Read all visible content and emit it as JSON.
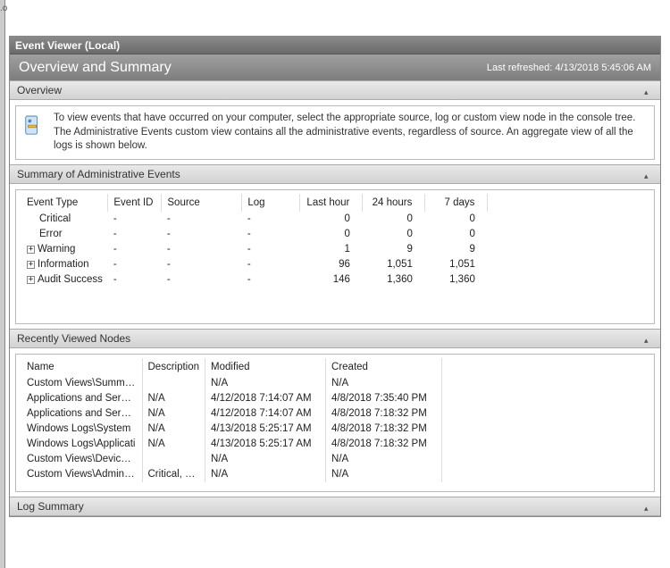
{
  "window": {
    "title": "Event Viewer (Local)",
    "edge_label": ".o"
  },
  "banner": {
    "title": "Overview and Summary",
    "refreshed_prefix": "Last refreshed: ",
    "refreshed_time": "4/13/2018 5:45:06 AM"
  },
  "overview": {
    "header": "Overview",
    "text": "To view events that have occurred on your computer, select the appropriate source, log or custom view node in the console tree. The Administrative Events custom view contains all the administrative events, regardless of source. An aggregate view of all the logs is shown below."
  },
  "summary": {
    "header": "Summary of Administrative Events",
    "columns": {
      "event_type": "Event Type",
      "event_id": "Event ID",
      "source": "Source",
      "log": "Log",
      "last_hour": "Last hour",
      "h24": "24 hours",
      "d7": "7 days"
    },
    "rows": [
      {
        "expand": "",
        "indent": true,
        "type": "Critical",
        "id": "-",
        "source": "-",
        "log": "-",
        "last_hour": "0",
        "h24": "0",
        "d7": "0"
      },
      {
        "expand": "",
        "indent": true,
        "type": "Error",
        "id": "-",
        "source": "-",
        "log": "-",
        "last_hour": "0",
        "h24": "0",
        "d7": "0"
      },
      {
        "expand": "+",
        "indent": false,
        "type": "Warning",
        "id": "-",
        "source": "-",
        "log": "-",
        "last_hour": "1",
        "h24": "9",
        "d7": "9"
      },
      {
        "expand": "+",
        "indent": false,
        "type": "Information",
        "id": "-",
        "source": "-",
        "log": "-",
        "last_hour": "96",
        "h24": "1,051",
        "d7": "1,051"
      },
      {
        "expand": "+",
        "indent": false,
        "type": "Audit Success",
        "id": "-",
        "source": "-",
        "log": "-",
        "last_hour": "146",
        "h24": "1,360",
        "d7": "1,360"
      }
    ]
  },
  "recent": {
    "header": "Recently Viewed Nodes",
    "columns": {
      "name": "Name",
      "description": "Description",
      "modified": "Modified",
      "created": "Created"
    },
    "rows": [
      {
        "name": "Custom Views\\Summary...",
        "desc": "",
        "modified": "N/A",
        "created": "N/A"
      },
      {
        "name": "Applications and Service...",
        "desc": "N/A",
        "modified": "4/12/2018 7:14:07 AM",
        "created": "4/8/2018 7:35:40 PM"
      },
      {
        "name": "Applications and Service...",
        "desc": "N/A",
        "modified": "4/12/2018 7:14:07 AM",
        "created": "4/8/2018 7:18:32 PM"
      },
      {
        "name": "Windows Logs\\System",
        "desc": "N/A",
        "modified": "4/13/2018 5:25:17 AM",
        "created": "4/8/2018 7:18:32 PM"
      },
      {
        "name": "Windows Logs\\Applicati",
        "desc": "N/A",
        "modified": "4/13/2018 5:25:17 AM",
        "created": "4/8/2018 7:18:32 PM"
      },
      {
        "name": "Custom Views\\Device M...",
        "desc": "",
        "modified": "N/A",
        "created": "N/A"
      },
      {
        "name": "Custom Views\\Administr...",
        "desc": "Critical, Er...",
        "modified": "N/A",
        "created": "N/A"
      }
    ]
  },
  "log_summary": {
    "header": "Log Summary"
  }
}
